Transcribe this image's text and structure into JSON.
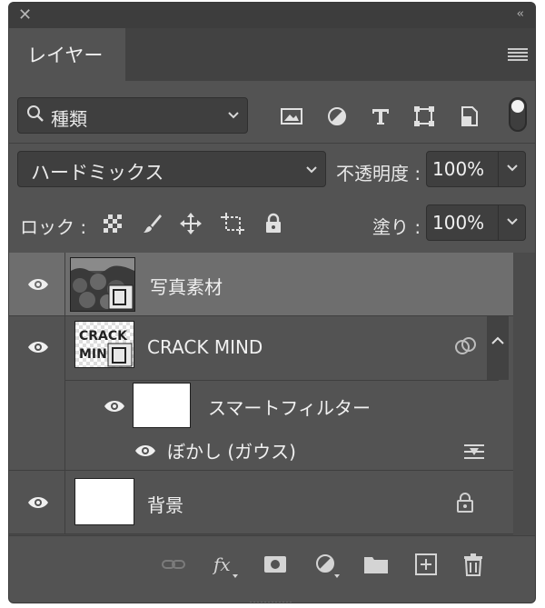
{
  "window": {
    "close_glyph": "✕",
    "collapse_glyph": "‹‹"
  },
  "tabs": [
    {
      "label": "レイヤー"
    }
  ],
  "filter": {
    "value": "種類",
    "icons": [
      "image-filter-icon",
      "adjustment-filter-icon",
      "type-filter-icon",
      "shape-filter-icon",
      "smart-object-filter-icon"
    ]
  },
  "blend": {
    "mode": "ハードミックス",
    "opacity_label": "不透明度 :",
    "opacity_value": "100%"
  },
  "lock": {
    "label": "ロック :",
    "fill_label": "塗り :",
    "fill_value": "100%"
  },
  "layers": [
    {
      "name": "写真素材",
      "selected": true,
      "type": "smart-object"
    },
    {
      "name": "CRACK  MIND",
      "selected": false,
      "type": "smart-object",
      "thumb_text": "CRACK MIND",
      "expanded": true
    },
    {
      "name": "スマートフィルター",
      "selected": false,
      "type": "smart-filter"
    },
    {
      "name": "ぼかし (ガウス)",
      "selected": false,
      "type": "filter"
    },
    {
      "name": "背景",
      "selected": false,
      "type": "background",
      "locked": true
    }
  ],
  "colors": {
    "panel": "#535353",
    "selected_row": "#6e6e6e",
    "field": "#3f3f3f"
  }
}
